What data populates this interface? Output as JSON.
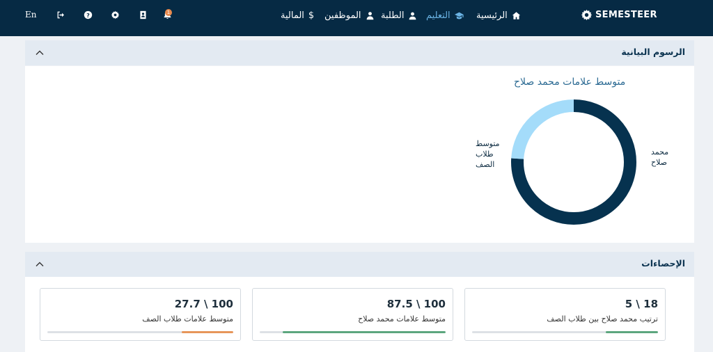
{
  "navbar": {
    "logo": "SEMESTEER",
    "items": [
      {
        "label": "الرئيسية",
        "icon": "home-icon"
      },
      {
        "label": "التعليم",
        "icon": "graduation-cap-icon",
        "active": true
      },
      {
        "label": "الطلبة",
        "icon": "students-icon"
      },
      {
        "label": "الموظفين",
        "icon": "employee-icon"
      },
      {
        "label": "المالية",
        "icon": "dollar-icon"
      }
    ],
    "notification_count": "1",
    "language": "En",
    "icons": [
      "bell-icon",
      "id-card-icon",
      "gear-icon",
      "help-icon",
      "logout-icon"
    ],
    "colors": {
      "bar": "#062a44",
      "active": "#6ab3e4"
    }
  },
  "charts_panel": {
    "title": "الرسوم البيانية",
    "chart_data": {
      "type": "pie",
      "title": "متوسط علامات محمد صلاح",
      "series": [
        {
          "name": "محمد صلاح",
          "value": 87.5,
          "color": "#06324f"
        },
        {
          "name": "متوسط طلاب الصف",
          "value": 27.7,
          "color": "#a4dcfa"
        }
      ],
      "legend_lines": {
        "student": [
          "محمد",
          "صلاح"
        ],
        "class": [
          "متوسط",
          "طلاب",
          "الصف"
        ]
      },
      "legend_placement": "sides"
    }
  },
  "stats_panel": {
    "title": "الإحصاءات",
    "cards": [
      {
        "value": "5 \\ 18",
        "caption": "ترتيب محمد صلاح بين طلاب الصف",
        "progress": 0.28,
        "color": "#5ca67e"
      },
      {
        "value": "87.5 \\ 100",
        "caption": "متوسط علامات محمد صلاح",
        "progress": 0.875,
        "color": "#5ca67e"
      },
      {
        "value": "27.7 \\ 100",
        "caption": "متوسط علامات طلاب الصف",
        "progress": 0.277,
        "color": "#e7965a"
      }
    ]
  }
}
